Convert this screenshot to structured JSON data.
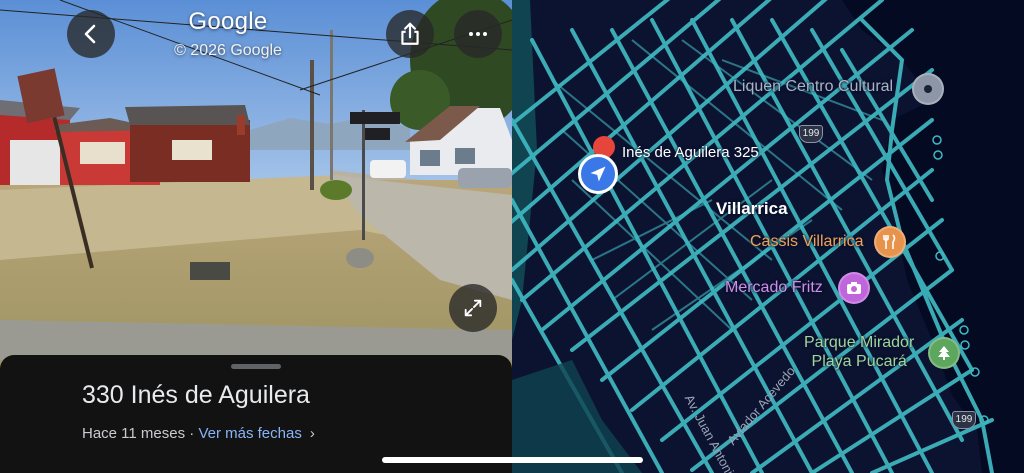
{
  "street_view": {
    "title": "Google",
    "copyright": "© 2026 Google",
    "sheet": {
      "address": "330 Inés de Aguilera",
      "date": "Hace 11 meses · ",
      "link": "Ver más fechas",
      "chevron": "›"
    },
    "icons": {
      "back": "chevron-left-icon",
      "share": "share-icon",
      "more": "more-horizontal-icon",
      "expand": "expand-icon"
    }
  },
  "map": {
    "labels": {
      "liquen": "Liquen Centro Cultural",
      "ines": "Inés de Aguilera 325",
      "villarrica": "Villarrica",
      "cassis": "Cassis Villarrica",
      "mercado": "Mercado Fritz",
      "parque_line1": "Parque Mirador",
      "parque_line2": "Playa Pucará"
    },
    "roads": {
      "acevedo": "Aviador Acevedo",
      "juan": "Av. Juan Antonio"
    },
    "shields": [
      "199",
      "199"
    ],
    "colors": {
      "background": "#0c1330",
      "streets": "#3fb9c2",
      "water": "#050a23",
      "food": "#e8934c",
      "shopping": "#c066dd",
      "park": "#5da65e",
      "location": "#3b78e7"
    }
  }
}
